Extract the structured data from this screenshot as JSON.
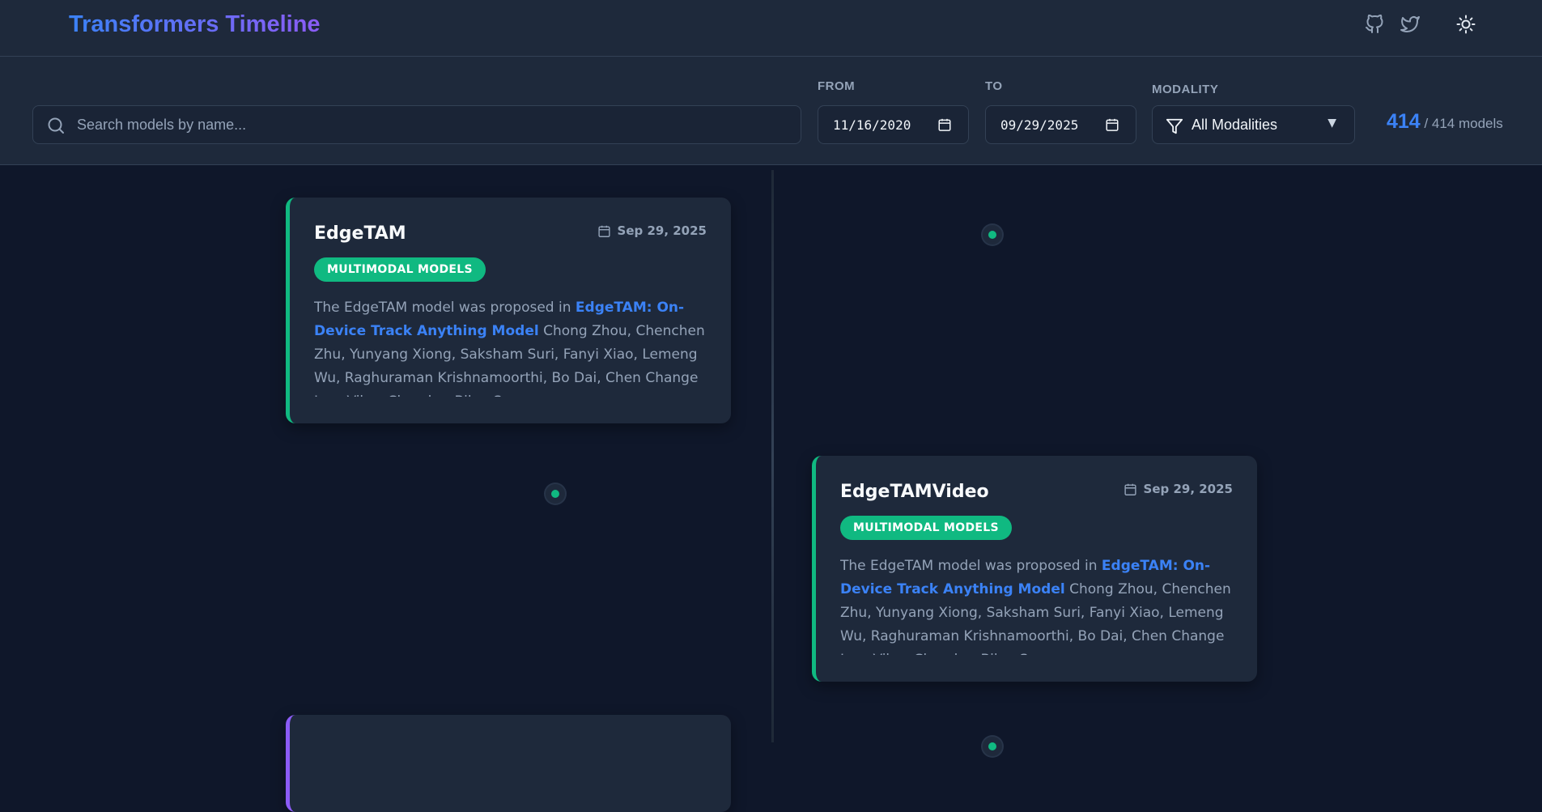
{
  "header": {
    "title": "Transformers Timeline",
    "icons": [
      "github-icon",
      "twitter-icon",
      "sun-icon"
    ]
  },
  "filters": {
    "search_placeholder": "Search models by name...",
    "from_label": "FROM",
    "from_value": "11/16/2020",
    "to_label": "TO",
    "to_value": "09/29/2025",
    "modality_label": "MODALITY",
    "modality_value": "All Modalities",
    "count_shown": "414",
    "count_total": "/ 414 models"
  },
  "colors": {
    "accent": "#3b82f6",
    "brand_gradient_end": "#8b5cf6",
    "multimodal": "#10b981",
    "background": "#0f172a",
    "surface": "#1e293b"
  },
  "cards": [
    {
      "title": "EdgeTAM",
      "date": "Sep 29, 2025",
      "badge": "MULTIMODAL MODELS",
      "desc_before": "The EdgeTAM model was proposed in ",
      "desc_link": "EdgeTAM: On-Device Track Anything Model",
      "desc_after": " Chong Zhou, Chenchen Zhu, Yunyang Xiong, Saksham Suri, Fanyi Xiao, Lemeng Wu, Raghuraman Krishnamoorthi, Bo Dai, Chen Change Loy, Vikas Chandra, Bilge Soran."
    },
    {
      "title": "EdgeTAMVideo",
      "date": "Sep 29, 2025",
      "badge": "MULTIMODAL MODELS",
      "desc_before": "The EdgeTAM model was proposed in ",
      "desc_link": "EdgeTAM: On-Device Track Anything Model",
      "desc_after": " Chong Zhou, Chenchen Zhu, Yunyang Xiong, Saksham Suri, Fanyi Xiao, Lemeng Wu, Raghuraman Krishnamoorthi, Bo Dai, Chen Change Loy, Vikas Chandra, Bilge Soran."
    }
  ]
}
